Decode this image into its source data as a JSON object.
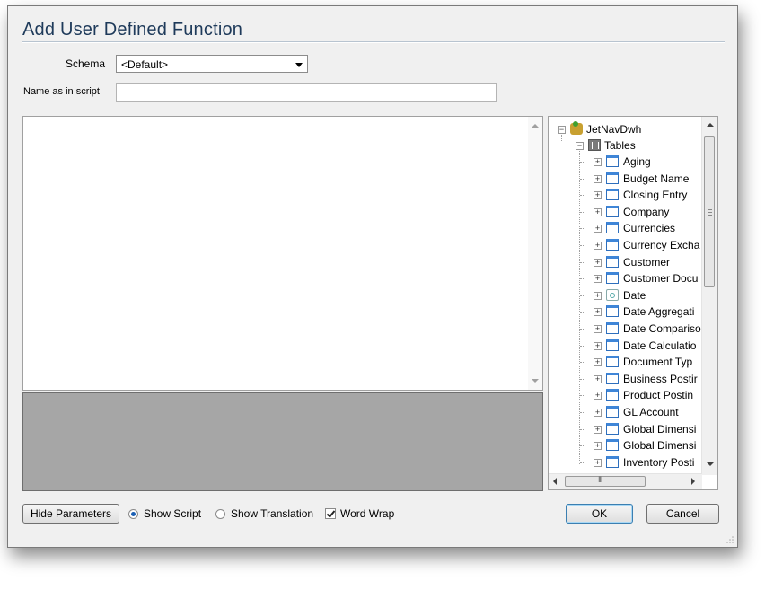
{
  "dialog": {
    "title": "Add User Defined Function",
    "schema_label": "Schema",
    "schema_value": "<Default>",
    "name_label": "Name as in script",
    "name_value": ""
  },
  "tree": {
    "root": "JetNavDwh",
    "folder": "Tables",
    "items": [
      {
        "label": "Aging",
        "icon": "table-icon"
      },
      {
        "label": "Budget Name",
        "icon": "table-icon"
      },
      {
        "label": "Closing Entry",
        "icon": "table-icon"
      },
      {
        "label": "Company",
        "icon": "table-icon"
      },
      {
        "label": "Currencies",
        "icon": "table-icon"
      },
      {
        "label": "Currency Excha",
        "icon": "table-icon"
      },
      {
        "label": "Customer",
        "icon": "table-icon"
      },
      {
        "label": "Customer Docu",
        "icon": "table-icon"
      },
      {
        "label": "Date",
        "icon": "date-dimension-icon"
      },
      {
        "label": "Date Aggregati",
        "icon": "table-icon"
      },
      {
        "label": "Date Compariso",
        "icon": "table-icon"
      },
      {
        "label": "Date Calculatio",
        "icon": "table-icon"
      },
      {
        "label": "Document Typ",
        "icon": "table-icon"
      },
      {
        "label": "Business Postir",
        "icon": "table-icon"
      },
      {
        "label": "Product Postin",
        "icon": "table-icon"
      },
      {
        "label": "GL Account",
        "icon": "table-icon"
      },
      {
        "label": "Global Dimensi",
        "icon": "table-icon"
      },
      {
        "label": "Global Dimensi",
        "icon": "table-icon"
      },
      {
        "label": "Inventory Posti",
        "icon": "table-icon"
      }
    ],
    "hscroll_grip": "III"
  },
  "footer": {
    "hide_parameters": "Hide Parameters",
    "show_script": "Show Script",
    "show_script_selected": true,
    "show_translation": "Show Translation",
    "word_wrap": "Word Wrap",
    "word_wrap_checked": true,
    "ok": "OK",
    "cancel": "Cancel"
  },
  "colors": {
    "title_text": "#1e3a5a",
    "translation_bg": "#a6a6a6",
    "table_icon": "#3f86d8"
  }
}
